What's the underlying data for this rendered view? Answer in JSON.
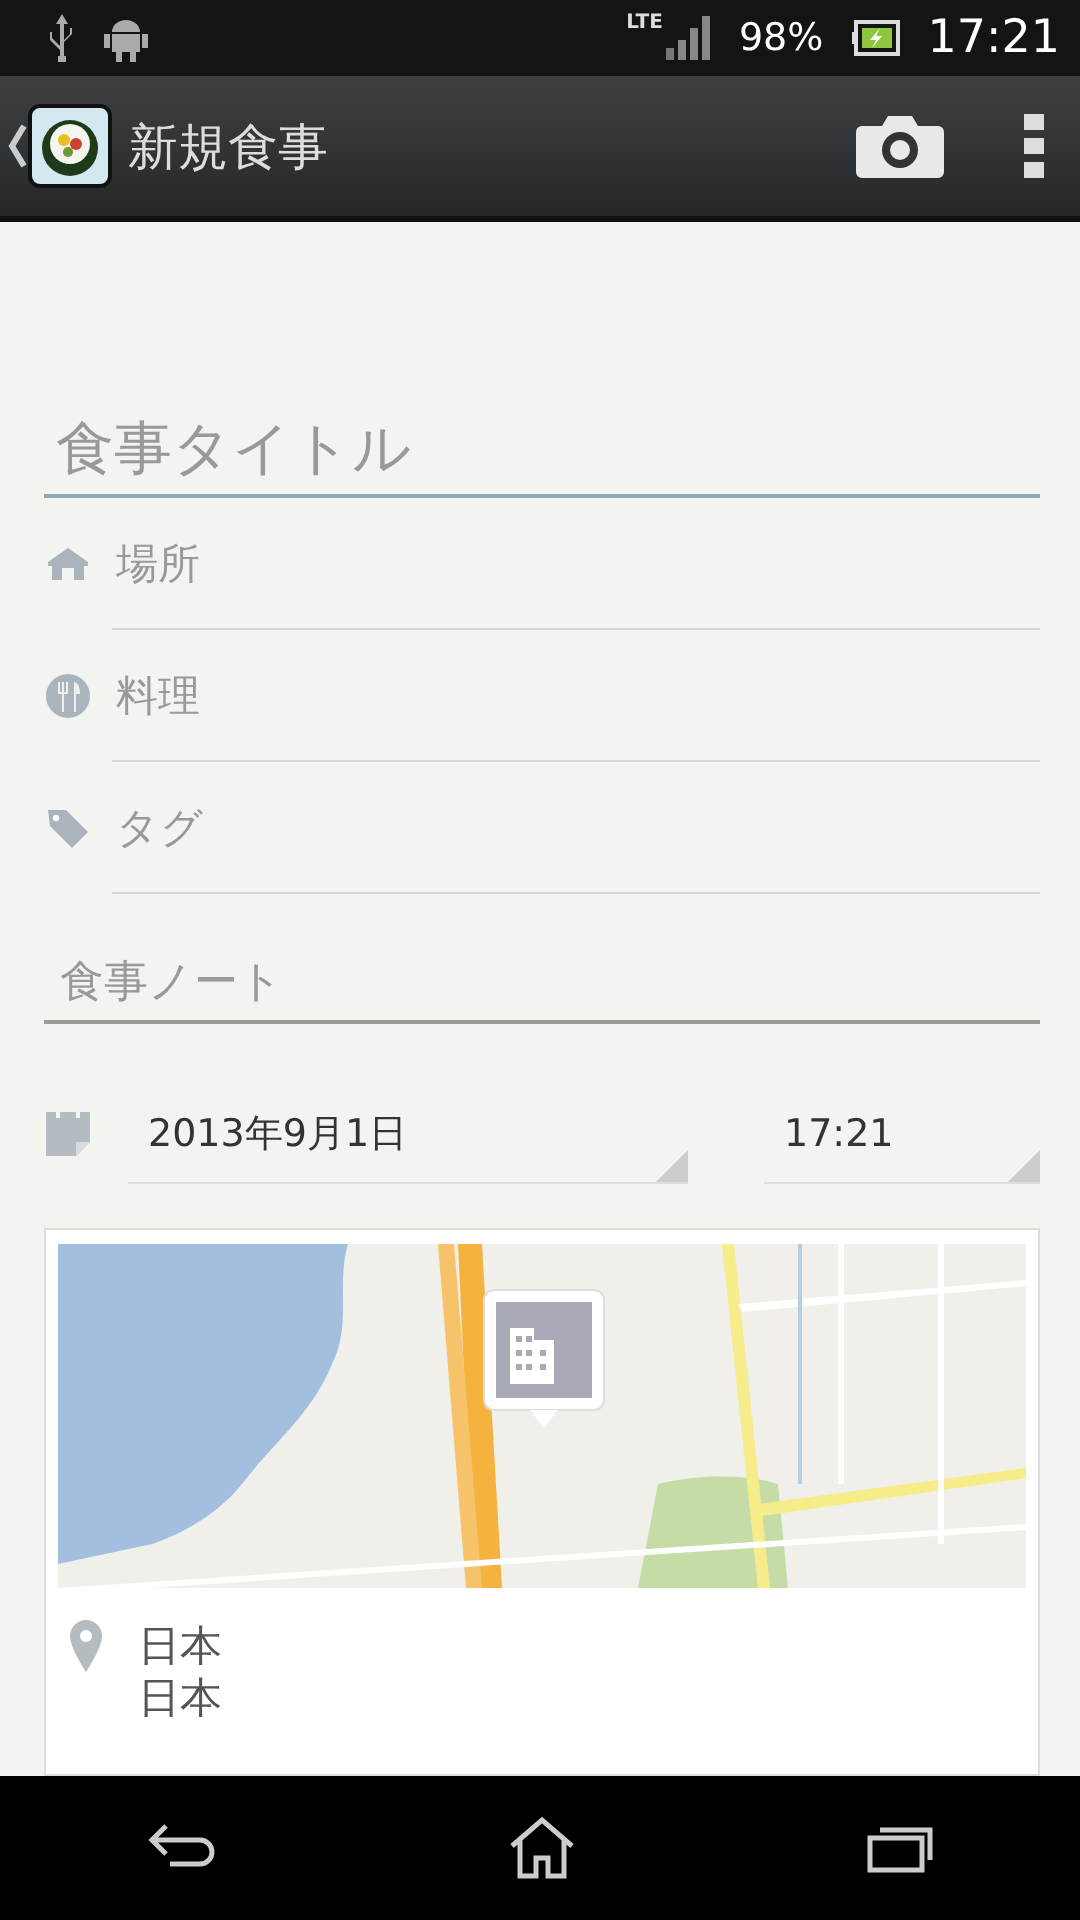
{
  "status_bar": {
    "network": "LTE",
    "battery": "98%",
    "time": "17:21"
  },
  "action_bar": {
    "title": "新規食事"
  },
  "title_field": {
    "placeholder": "食事タイトル"
  },
  "fields": [
    {
      "kind": "place",
      "placeholder": "場所"
    },
    {
      "kind": "dish",
      "placeholder": "料理"
    },
    {
      "kind": "tag",
      "placeholder": "タグ"
    }
  ],
  "notes_field": {
    "placeholder": "食事ノート"
  },
  "date": "2013年9月1日",
  "time": "17:21",
  "location": {
    "lines": [
      "日本",
      "日本"
    ]
  }
}
